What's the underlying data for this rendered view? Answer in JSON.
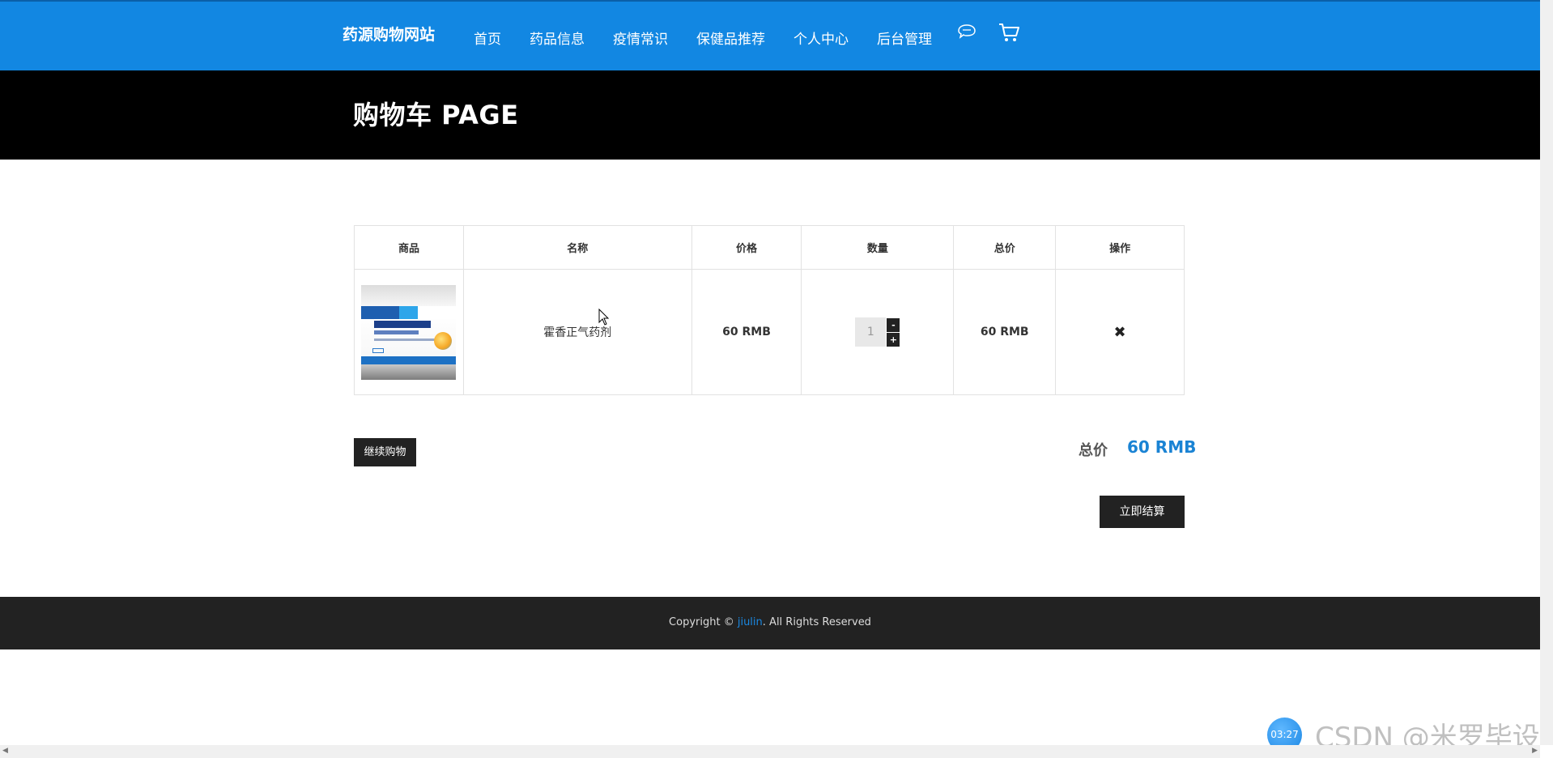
{
  "header": {
    "brand": "药源购物网站",
    "nav": [
      "首页",
      "药品信息",
      "疫情常识",
      "保健品推荐",
      "个人中心",
      "后台管理"
    ],
    "icons": [
      "chat-icon",
      "cart-icon"
    ],
    "bg_color": "#1287e2"
  },
  "banner": {
    "title": "购物车 PAGE"
  },
  "cart": {
    "columns": [
      "商品",
      "名称",
      "价格",
      "数量",
      "总价",
      "操作"
    ],
    "items": [
      {
        "image_icon": "product-image",
        "name": "霍香正气药剂",
        "price": "60 RMB",
        "quantity": "1",
        "total": "60 RMB",
        "remove_icon": "✖"
      }
    ],
    "qty_minus": "-",
    "qty_plus": "+"
  },
  "actions": {
    "continue_label": "继续购物",
    "total_label": "总价",
    "total_value": "60 RMB",
    "checkout_label": "立即结算"
  },
  "footer": {
    "prefix": "Copyright © ",
    "link": "jiulin",
    "suffix": ". All Rights Reserved"
  },
  "overlay": {
    "timer": "03:27",
    "watermark": "CSDN @米罗毕设"
  },
  "colors": {
    "accent": "#1a83d4",
    "dark": "#222222",
    "title_band": "#000000"
  }
}
